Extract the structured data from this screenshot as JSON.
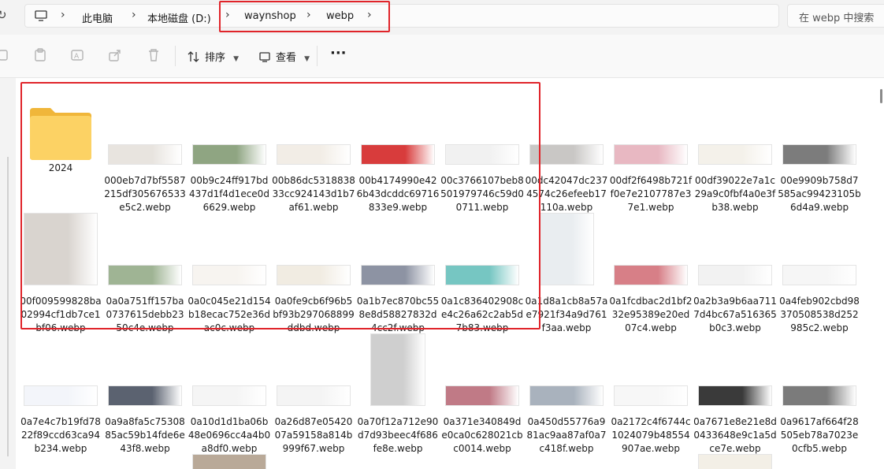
{
  "address": {
    "breadcrumbs": [
      "此电脑",
      "本地磁盘 (D:)",
      "waynshop",
      "webp"
    ],
    "search_placeholder": "在 webp 中搜索"
  },
  "toolbar": {
    "sort_label": "排序",
    "view_label": "查看",
    "more_label": "···"
  },
  "files": [
    {
      "name": "2024",
      "folder": true
    },
    {
      "name": "000eb7d7bf5587215df305676533e5c2.webp",
      "color": "#e8e4df",
      "aspect": "wide"
    },
    {
      "name": "00b9c24ff917bd437d1f4d1ece0d6629.webp",
      "color": "#8fa582",
      "aspect": "wide"
    },
    {
      "name": "00b86dc531883833cc924143d1b7af61.webp",
      "color": "#f2ede6",
      "aspect": "wide"
    },
    {
      "name": "00b4174990e426b43dcddc69716833e9.webp",
      "color": "#d83c3c",
      "aspect": "wide"
    },
    {
      "name": "00c3766107beb8501979746c59d00711.webp",
      "color": "#f1f1f1",
      "aspect": "wide"
    },
    {
      "name": "00dc42047dc2374574c26efeeb17110a.webp",
      "color": "#c9c7c5",
      "aspect": "wide"
    },
    {
      "name": "00df2f6498b721ff0e7e2107787e37e1.webp",
      "color": "#e8b8c2",
      "aspect": "wide"
    },
    {
      "name": "00df39022e7a1c29a9c0fbf4a0e3fb38.webp",
      "color": "#f4f1ea",
      "aspect": "wide"
    },
    {
      "name": "00e9909b758d7585ac99423105b6d4a9.webp",
      "color": "#7c7c7c",
      "aspect": "wide"
    },
    {
      "name": "00f009599828ba02994cf1db7ce1bf06.webp",
      "color": "#d9d4cf",
      "aspect": "square"
    },
    {
      "name": "0a0a751ff157ba0737615debb2350c4e.webp",
      "color": "#9fb494",
      "aspect": "wide"
    },
    {
      "name": "0a0c045e21d154b18ecac752e36dac0c.webp",
      "color": "#f7f4f0",
      "aspect": "wide"
    },
    {
      "name": "0a0fe9cb6f96b5bf93b297068899ddbd.webp",
      "color": "#f1ece2",
      "aspect": "wide"
    },
    {
      "name": "0a1b7ec870bc558e8d58827832d4cc2f.webp",
      "color": "#8d93a3",
      "aspect": "wide"
    },
    {
      "name": "0a1c836402908ce4c26a62c2ab5d7b83.webp",
      "color": "#76c6c2",
      "aspect": "wide"
    },
    {
      "name": "0a1d8a1cb8a57ae7921f34a9d761f3aa.webp",
      "color": "#e9edf0",
      "aspect": "tall"
    },
    {
      "name": "0a1fcdbac2d1bf232e95389e20ed07c4.webp",
      "color": "#d77f87",
      "aspect": "wide"
    },
    {
      "name": "0a2b3a9b6aa7117d4bc67a516365b0c3.webp",
      "color": "#f2f2f2",
      "aspect": "wide"
    },
    {
      "name": "0a4feb902cbd98370508538d252985c2.webp",
      "color": "#f6f6f6",
      "aspect": "wide"
    },
    {
      "name": "0a7e4c7b19fd7822f89ccd63ca94b234.webp",
      "color": "#f3f5fa",
      "aspect": "wide"
    },
    {
      "name": "0a9a8fa5c7530885ac59b14fde6e43f8.webp",
      "color": "#5b6270",
      "aspect": "wide"
    },
    {
      "name": "0a10d1d1ba06b48e0696cc4a4b0a8df0.webp",
      "color": "#f5f5f5",
      "aspect": "wide"
    },
    {
      "name": "0a26d87e0542007a59158a814b999f67.webp",
      "color": "#f4f4f4",
      "aspect": "wide"
    },
    {
      "name": "0a70f12a712e90d7d93beec4f686fe8e.webp",
      "color": "#cfcfcf",
      "aspect": "tall"
    },
    {
      "name": "0a371e340849de0ca0c628021cbc0014.webp",
      "color": "#c07a86",
      "aspect": "wide"
    },
    {
      "name": "0a450d55776a981ac9aa87af0a7c418f.webp",
      "color": "#a9b2bd",
      "aspect": "wide"
    },
    {
      "name": "0a2172c4f6744c1024079b48554907ae.webp",
      "color": "#f7f7f7",
      "aspect": "wide"
    },
    {
      "name": "0a7671e8e21e8d0433648e9c1a5dce7e.webp",
      "color": "#3a3a3a",
      "aspect": "wide"
    },
    {
      "name": "0a9617af664f28505eb78a7023e0cfb5.webp",
      "color": "#7b7b7b",
      "aspect": "wide"
    }
  ],
  "partial_next_row": [
    {
      "col": 2,
      "color": "#b9a998"
    },
    {
      "col": 8,
      "color": "#f3efe6"
    }
  ]
}
